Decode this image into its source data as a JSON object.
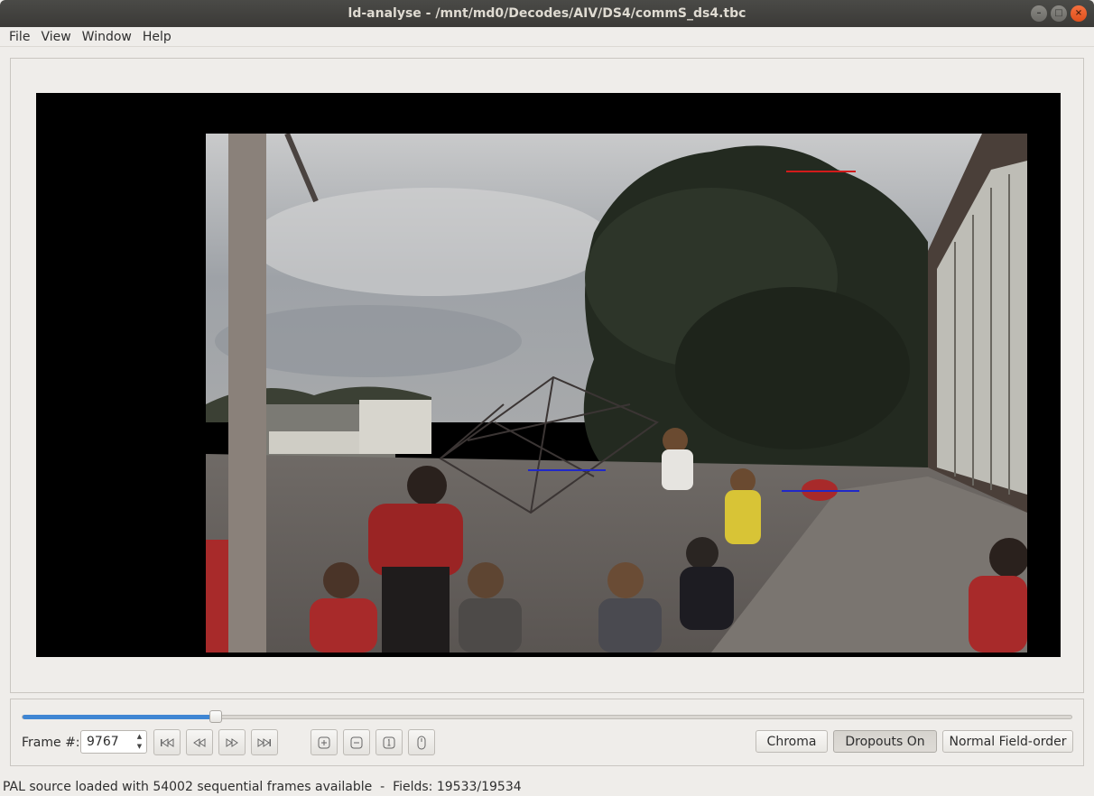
{
  "window": {
    "title": "ld-analyse - /mnt/md0/Decodes/AIV/DS4/commS_ds4.tbc",
    "minimize_glyph": "–",
    "maximize_glyph": "□",
    "close_glyph": "×"
  },
  "menu": [
    "File",
    "View",
    "Window",
    "Help"
  ],
  "video": {
    "content": "playground scene video frame"
  },
  "controls": {
    "slider_position": 0.1842,
    "frame_label": "Frame #:",
    "frame_number": "9767",
    "nav_icons": [
      "skip-first-icon",
      "step-back-icon",
      "step-forward-icon",
      "skip-last-icon"
    ],
    "tool_icons": [
      "zoom-in-icon",
      "zoom-out-icon",
      "zoom-original-icon",
      "mouse-mode-icon"
    ],
    "chroma_button": "Chroma",
    "dropouts_button": "Dropouts On",
    "field_order_button": "Normal Field-order"
  },
  "status": {
    "message": "PAL source loaded with 54002 sequential frames available  -  Fields: 19533/19534"
  },
  "colors": {
    "accent": "#3f86d3",
    "close_button": "#e8561f",
    "titlebar": "#3e3d39"
  }
}
